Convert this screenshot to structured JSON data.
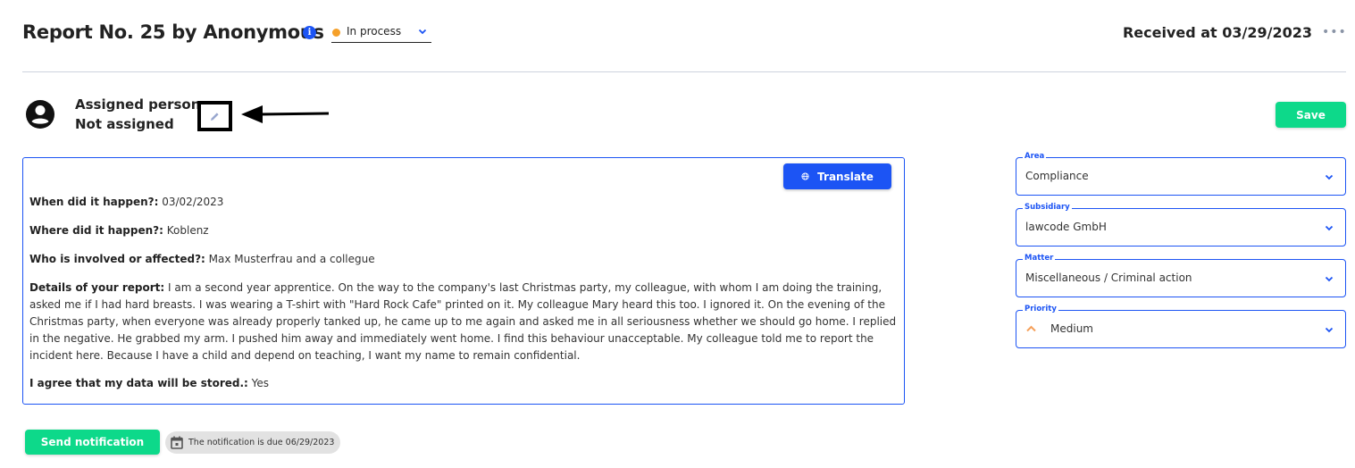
{
  "header": {
    "title": "Report No. 25 by Anonymous",
    "info_icon": "info-icon",
    "status": {
      "label": "In process",
      "dot_color": "#f5a02a"
    },
    "received": "Received at 03/29/2023",
    "more_icon": "more-horizontal-icon"
  },
  "assignment": {
    "label": "Assigned person:",
    "value": "Not assigned",
    "edit_icon": "pencil-icon",
    "annotation": "arrow-pointing-left"
  },
  "actions": {
    "save_label": "Save",
    "translate_label": "Translate",
    "send_notification_label": "Send notification",
    "notification_due": "The notification is due 06/29/2023"
  },
  "report": {
    "fields": [
      {
        "question": "When did it happen?:",
        "answer": "03/02/2023"
      },
      {
        "question": "Where did it happen?:",
        "answer": "Koblenz"
      },
      {
        "question": "Who is involved or affected?:",
        "answer": "Max Musterfrau and a collegue"
      },
      {
        "question": "Details of your report:",
        "answer": "I am a second year apprentice. On the way to the company's last Christmas party, my colleague, with whom I am doing the training, asked me if I had hard breasts. I was wearing a T-shirt with \"Hard Rock Cafe\" printed on it. My colleague Mary heard this too. I ignored it. On the evening of the Christmas party, when everyone was already properly tanked up, he came up to me again and asked me in all seriousness whether we should go home. I replied in the negative. He grabbed my arm. I pushed him away and immediately went home. I find this behaviour unacceptable. My colleague told me to report the incident here. Because I have a child and depend on teaching, I want my name to remain confidential."
      },
      {
        "question": "I agree that my data will be stored.:",
        "answer": "Yes"
      }
    ]
  },
  "sidebar": {
    "area": {
      "label": "Area",
      "value": "Compliance"
    },
    "subsidiary": {
      "label": "Subsidiary",
      "value": "lawcode GmbH"
    },
    "matter": {
      "label": "Matter",
      "value": "Miscellaneous / Criminal action"
    },
    "priority": {
      "label": "Priority",
      "value": "Medium",
      "icon_color": "#f5a05a"
    }
  },
  "colors": {
    "primary": "#1c54f4",
    "success": "#0dd98a",
    "divider": "#cdd3de"
  }
}
